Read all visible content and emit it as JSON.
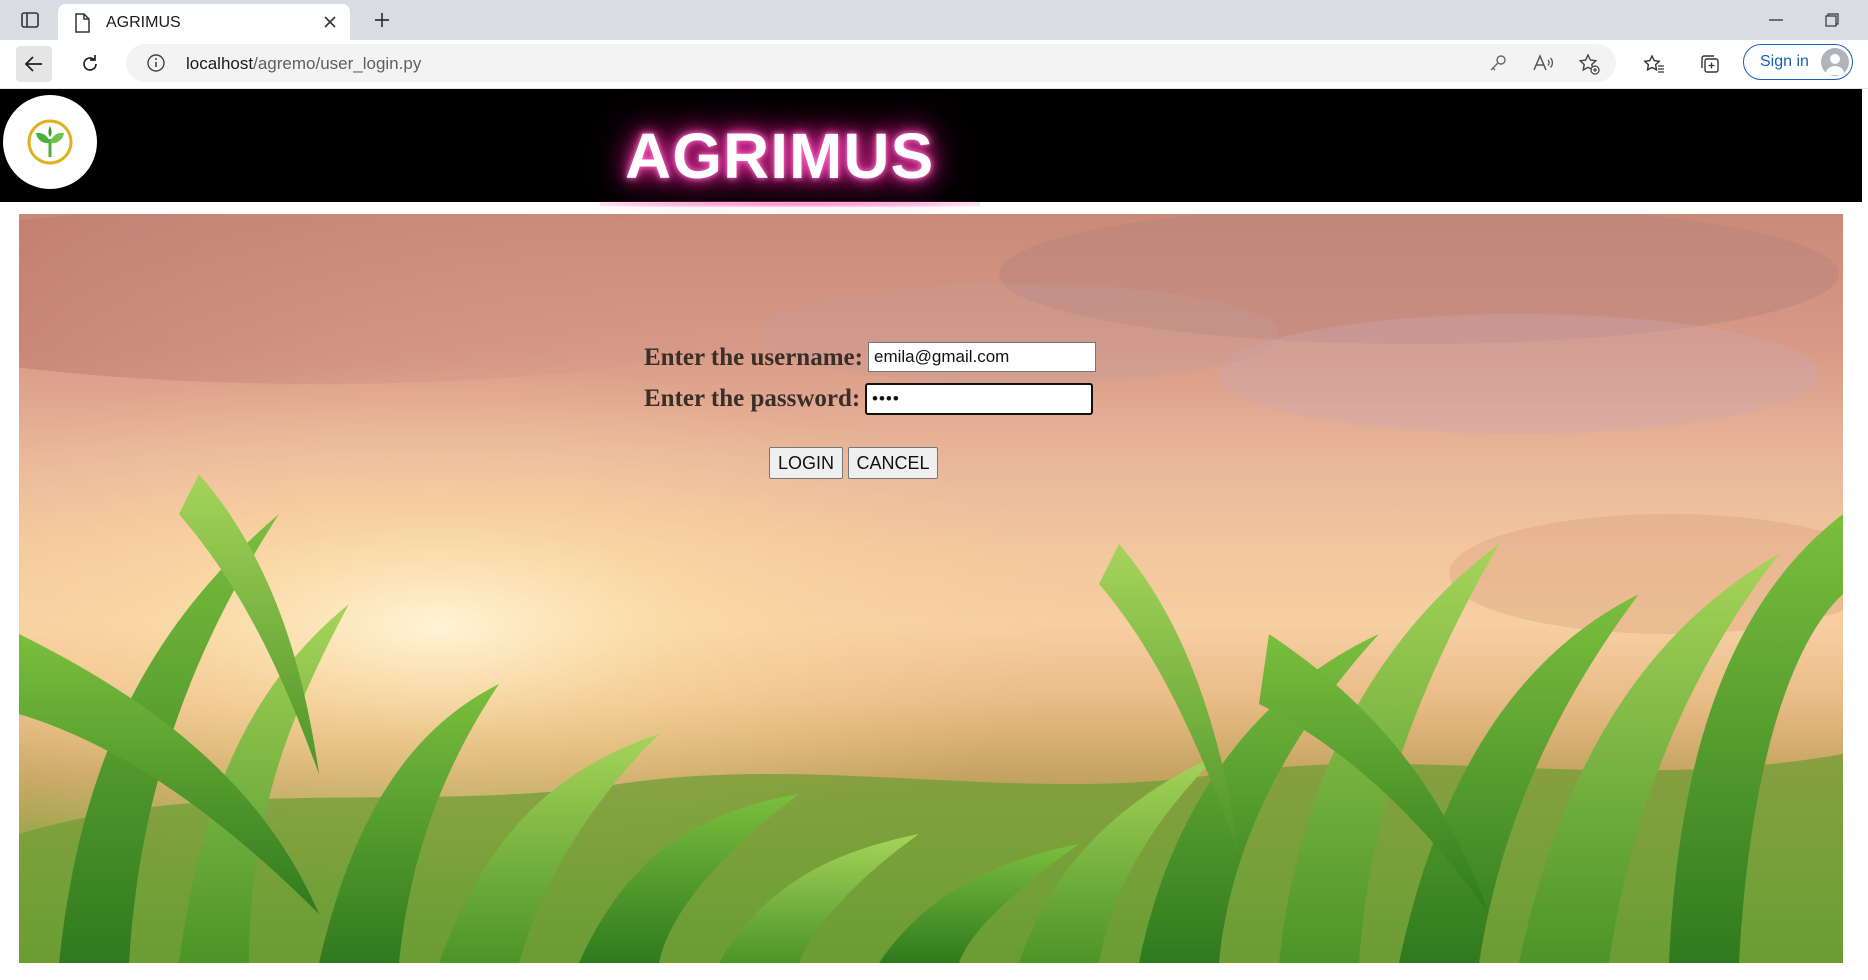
{
  "browser": {
    "tab_title": "AGRIMUS",
    "url_host": "localhost",
    "url_path": "/agremo/user_login.py",
    "sign_in_label": "Sign in"
  },
  "site": {
    "brand": "AGRIMUS"
  },
  "login_form": {
    "username_label": "Enter the username:",
    "username_value": "emila@gmail.com",
    "password_label": "Enter the password:",
    "password_value": "••••",
    "login_button": "LOGIN",
    "cancel_button": "CANCEL"
  },
  "colors": {
    "header_bg": "#000000",
    "brand_glow": "#ff3fb4",
    "logo_leaf": "#4caf3c",
    "logo_ring": "#e0b020",
    "signin_accent": "#1a5fb4"
  }
}
